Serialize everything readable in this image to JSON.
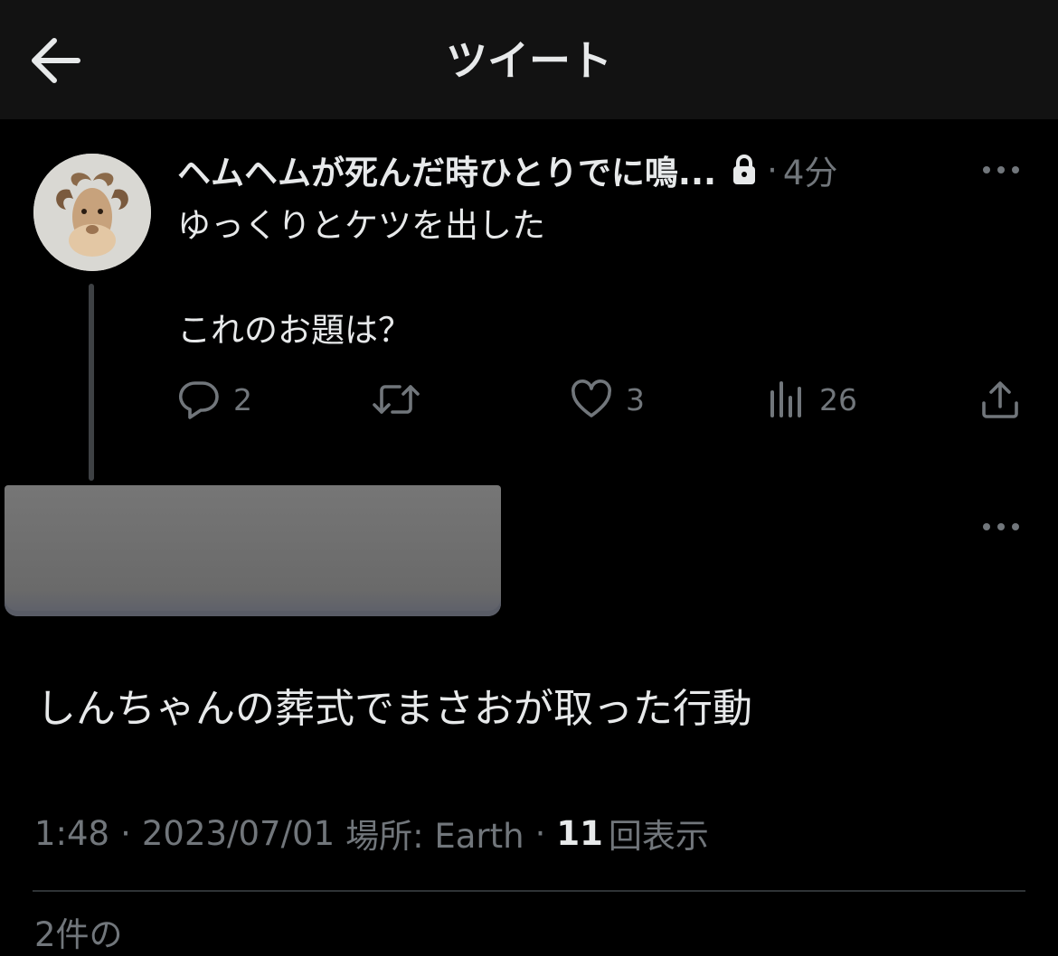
{
  "header": {
    "title": "ツイート"
  },
  "quoted_tweet": {
    "display_name": "ヘムヘムが死んだ時ひとりでに鳴...",
    "separator": "·",
    "time_ago": "4分",
    "text_line1": "ゆっくりとケツを出した",
    "text_line2": "これのお題は？",
    "stats": {
      "replies": "2",
      "likes": "3",
      "views": "26"
    }
  },
  "main_tweet": {
    "text": "しんちゃんの葬式でまさおが取った行動",
    "meta": {
      "time": "1:48",
      "date": "2023/07/01",
      "location": "場所: Earth",
      "separator": "·",
      "views_count": "11",
      "views_label": "回表示"
    }
  },
  "footer": {
    "partial_text": "2件の"
  },
  "colors": {
    "background": "#000000",
    "header_bg": "#121212",
    "text_primary": "#e7e9ea",
    "text_secondary": "#71767b",
    "thread_line": "#3e4144",
    "redaction": "#6f6f6f"
  },
  "icons": {
    "back": "arrow-left-icon",
    "lock": "lock-icon",
    "more": "more-horizontal-icon",
    "reply": "reply-bubble-icon",
    "retweet": "retweet-icon",
    "like": "heart-icon",
    "views": "bar-chart-icon",
    "share": "share-upload-icon"
  }
}
